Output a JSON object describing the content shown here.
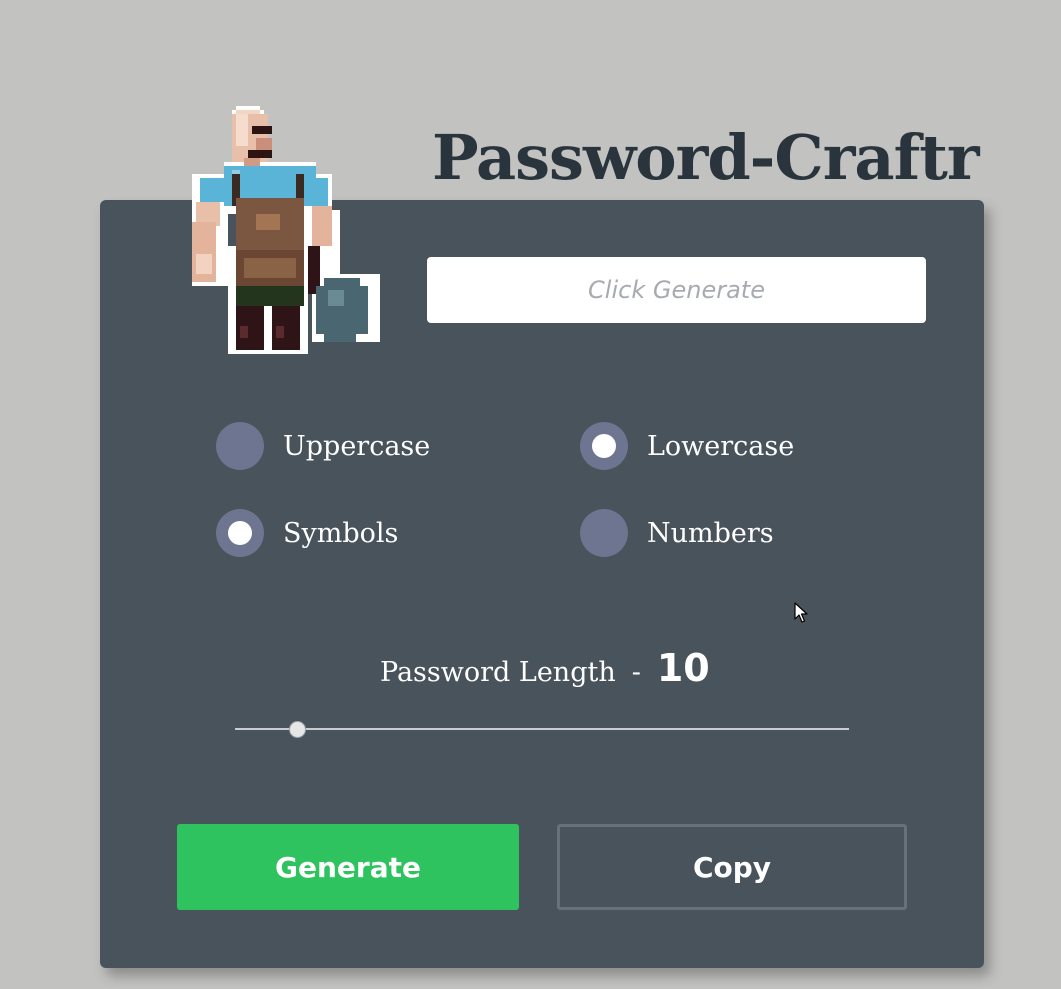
{
  "app": {
    "title": "Password-Craftr"
  },
  "output": {
    "placeholder": "Click Generate",
    "value": ""
  },
  "options": [
    {
      "label": "Uppercase",
      "checked": false
    },
    {
      "label": "Lowercase",
      "checked": true
    },
    {
      "label": "Symbols",
      "checked": true
    },
    {
      "label": "Numbers",
      "checked": false
    }
  ],
  "length": {
    "label": "Password Length",
    "separator": "-",
    "value": "10"
  },
  "buttons": {
    "generate": "Generate",
    "copy": "Copy"
  },
  "colors": {
    "background": "#c2c2c0",
    "card": "#48535c",
    "title": "#2a343d",
    "radio": "#6d7590",
    "generate": "#2ec35f",
    "copy_border": "#66717c"
  },
  "icons": {
    "mascot": "pixel-blacksmith-icon",
    "cursor": "mouse-pointer-icon"
  }
}
